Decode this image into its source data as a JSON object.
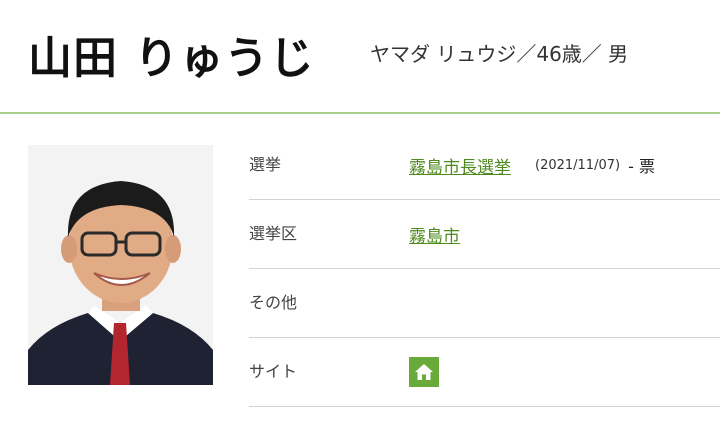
{
  "profile": {
    "name": "山田 りゅうじ",
    "reading": "ヤマダ リュウジ／46歳／ 男",
    "photo_icon": "candidate-photo"
  },
  "details": {
    "election_label": "選挙",
    "election_link": "霧島市長選挙",
    "election_date": "(2021/11/07)",
    "votes": "- 票",
    "district_label": "選挙区",
    "district_link": "霧島市",
    "other_label": "その他",
    "site_label": "サイト",
    "site_icon": "home-icon"
  },
  "colors": {
    "accent": "#6aaa3a",
    "link": "#4f8a1f",
    "header_rule": "#a8cf8a"
  }
}
